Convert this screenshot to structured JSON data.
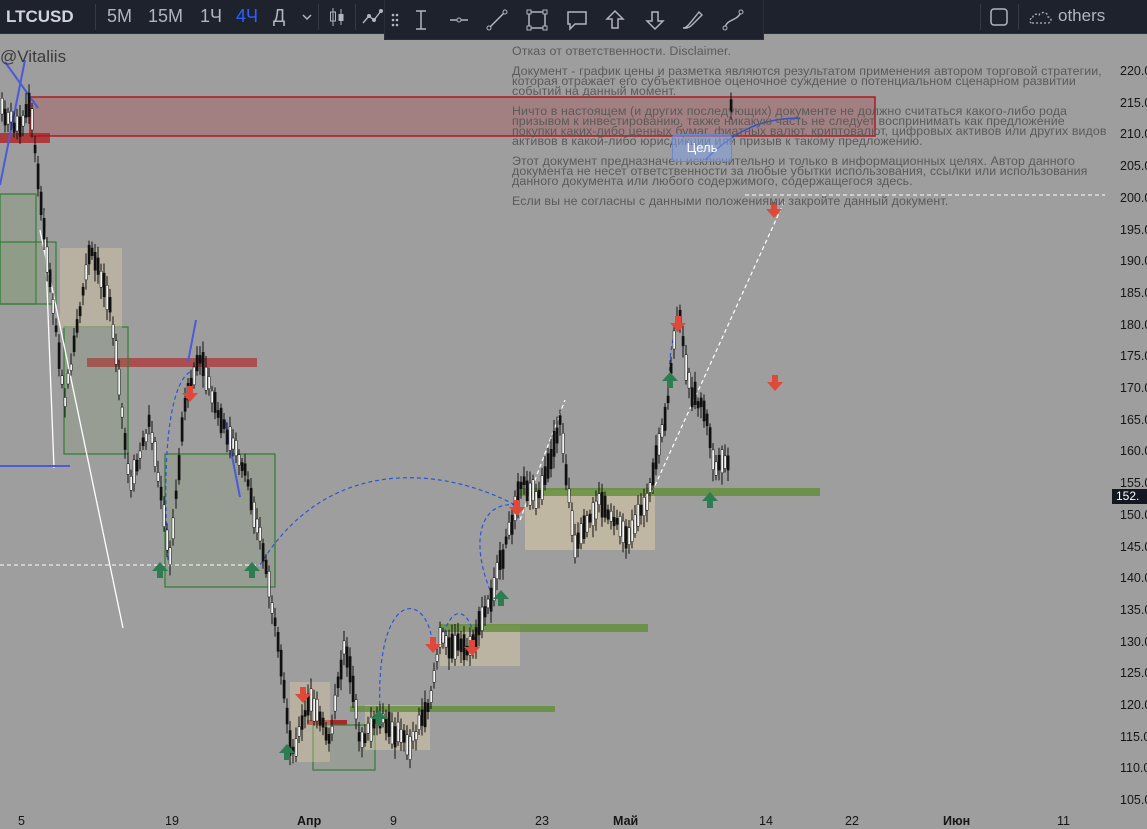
{
  "toolbar": {
    "symbol": "LTCUSD",
    "timeframes": [
      "5M",
      "15M",
      "1Ч",
      "4Ч",
      "Д"
    ],
    "active_timeframe": "4Ч",
    "others_label": "others"
  },
  "chart": {
    "watermark": "@Vitaliis",
    "disclaimer": [
      "Отказ от ответственности. Disclaimer.",
      "Документ - график цены и разметка являются результатом применения автором торговой стратегии, которая отражает его субъективное оценочное суждение о потенциальном сценарном развитии событий на данный момент.",
      "Ничто в настоящем (и других последующих) документе не должно считаться какого-либо рода призывом к инвестированию, также никакую часть не следует воспринимать как предложение покупки каких-либо ценных бумаг, фиатных валют, криптовалют, цифровых активов или других видов активов в какой-либо юрисдикции или призыв к такому предложению.",
      "Этот документ предназначен исключительно и только в информационных целях. Автор данного документа не несет ответственности за любые убытки использования, ссылки или использования данного документа или любого содержимого, содержащегося здесь.",
      "Если вы не согласны с данными положениями закройте данный документ."
    ],
    "target_label": "Цель",
    "current_price": "152.",
    "price_axis": [
      "220.0",
      "215.0",
      "210.0",
      "205.0",
      "200.0",
      "195.0",
      "190.0",
      "185.0",
      "180.0",
      "175.0",
      "170.0",
      "165.0",
      "160.0",
      "155.0",
      "150.0",
      "145.0",
      "140.0",
      "135.0",
      "130.0",
      "125.0",
      "120.0",
      "115.0",
      "110.0",
      "105.0"
    ],
    "time_axis": [
      {
        "label": "5",
        "bold": false
      },
      {
        "label": "19",
        "bold": false
      },
      {
        "label": "Апр",
        "bold": true
      },
      {
        "label": "9",
        "bold": false
      },
      {
        "label": "23",
        "bold": false
      },
      {
        "label": "Май",
        "bold": true
      },
      {
        "label": "14",
        "bold": false
      },
      {
        "label": "22",
        "bold": false
      },
      {
        "label": "Июн",
        "bold": true
      },
      {
        "label": "11",
        "bold": false
      }
    ]
  },
  "colors": {
    "toolbar_bg": "#1e222d",
    "chart_bg": "#9e9e9e",
    "active_timeframe": "#2962ff",
    "resistance": "#b0191e",
    "support": "#5b8c2f",
    "arrow_up": "#2e7d52",
    "arrow_down": "#e0483a",
    "projection": "#2c54d6"
  }
}
